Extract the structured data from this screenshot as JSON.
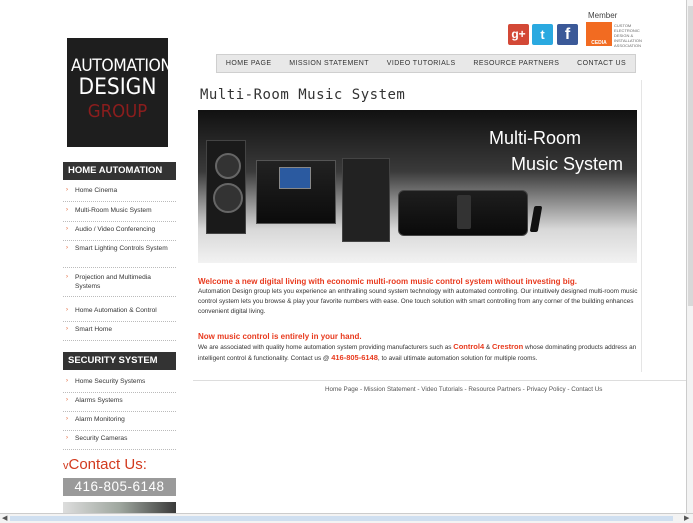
{
  "logo": {
    "line1": "AUTOMATION",
    "line2": "DESIGN",
    "line3": "GROUP"
  },
  "social": {
    "gplus": "g+",
    "twitter": "t",
    "facebook": "f"
  },
  "cedia": {
    "member": "Member",
    "box": "CEDIA",
    "text": "CUSTOM ELECTRONIC DESIGN & INSTALLATION ASSOCIATION"
  },
  "nav": [
    "HOME PAGE",
    "MISSION STATEMENT",
    "VIDEO TUTORIALS",
    "RESOURCE PARTNERS",
    "CONTACT US"
  ],
  "page_title": "Multi-Room Music System",
  "banner": {
    "line1": "Multi-Room",
    "line2": "Music System"
  },
  "intro": {
    "heading": "Welcome a new digital living with economic multi-room music control system without investing big.",
    "body": "Automation Design group lets you experience an enthralling sound system technology with automated controlling. Our intuitively designed multi-room music control system lets you browse & play your favorite numbers with ease. One touch solution with smart controlling from any corner of the building enhances convenient digital living."
  },
  "control": {
    "heading": "Now music control is entirely in your hand.",
    "pre": "We are associated with quality home automation system providing manufacturers such as ",
    "brand1": "Control4",
    "amp": " & ",
    "brand2": "Crestron",
    "mid": " whose dominating products address an intelligent control & functionality. Contact us @ ",
    "phone": "416-805-6148",
    "post": ", to avail ultimate automation solution for multiple rooms."
  },
  "footer": "Home Page - Mission Statement - Video Tutorials - Resource Partners - Privacy Policy - Contact Us",
  "sidebar": {
    "home_automation": {
      "title": "HOME AUTOMATION",
      "items": [
        "Home Cinema",
        "Multi-Room Music System",
        "Audio / Video Conferencing",
        "Smart Lighting Controls System",
        "Projection and Multimedia Systems",
        "Home Automation & Control",
        "Smart Home"
      ]
    },
    "security": {
      "title": "SECURITY SYSTEM",
      "items": [
        "Home Security Systems",
        "Alarms Systems",
        "Alarm Monitoring",
        "Security Cameras"
      ]
    },
    "contact_title": "Contact Us:",
    "contact_phone": "416-805-6148"
  },
  "icons": {
    "arrow": "›",
    "chevron": "v"
  }
}
